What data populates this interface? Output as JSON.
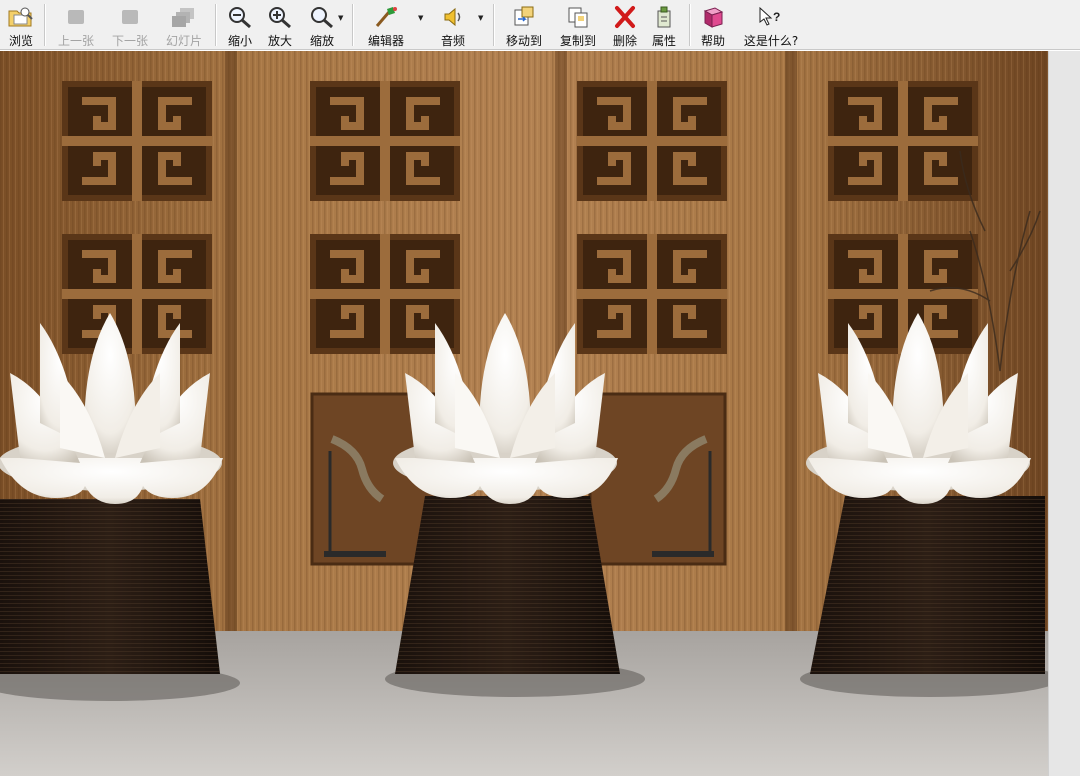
{
  "toolbar": {
    "browse": "浏览",
    "prev": "上一张",
    "next": "下一张",
    "slideshow": "幻灯片",
    "zoom_out": "缩小",
    "zoom_in": "放大",
    "zoom": "缩放",
    "editor": "编辑器",
    "audio": "音频",
    "move_to": "移动到",
    "copy_to": "复制到",
    "delete": "删除",
    "properties": "属性",
    "help": "帮助",
    "whats_this": "这是什么?"
  },
  "icons": {
    "browse": "folder-icon",
    "prev": "previous-icon",
    "next": "next-icon",
    "slideshow": "slideshow-icon",
    "zoom_out": "zoom-out-icon",
    "zoom_in": "zoom-in-icon",
    "zoom": "zoom-icon",
    "editor": "editor-brush-icon",
    "audio": "speaker-icon",
    "move_to": "move-icon",
    "copy_to": "copy-icon",
    "delete": "delete-x-icon",
    "properties": "properties-icon",
    "help": "help-book-icon",
    "whats_this": "whats-this-icon"
  },
  "colors": {
    "toolbar_bg": "#f0f0f0",
    "disabled_text": "#a3a3a3",
    "wood": "#9a6a3a",
    "delete_red": "#d11a1a"
  }
}
